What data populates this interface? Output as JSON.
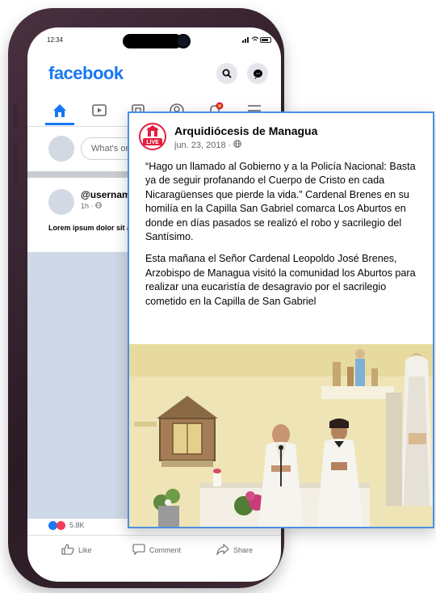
{
  "statusbar": {
    "time": "12:34"
  },
  "app": {
    "logo": "facebook"
  },
  "composer": {
    "placeholder": "What's on your mind?"
  },
  "feed_post": {
    "username": "@username",
    "meta": "1h · ",
    "text": "Lorem ipsum dolor sit amet, consectetur adipiscingelit."
  },
  "reactions": {
    "count": "5.8K"
  },
  "actions": {
    "like": "Like",
    "comment": "Comment",
    "share": "Share"
  },
  "card": {
    "page_name": "Arquidiócesis de Managua",
    "logo_badge": "LIVE",
    "date": "jun. 23, 2018 · ",
    "paragraph1": "“Hago un llamado al Gobierno y a la Policía Nacional: Basta ya de seguir profanando el Cuerpo de Cristo en cada Nicaragüenses que pierde la vida.” Cardenal Brenes en su homilía en la Capilla San Gabriel comarca Los Aburtos en donde en días pasados se realizó el robo y sacrilegio del Santísimo.",
    "paragraph2": "Esta mañana el Señor Cardenal Leopoldo José Brenes, Arzobispo de Managua visitó la comunidad los Aburtos para realizar una eucaristía de desagravio por el sacrilegio cometido en la Capilla de San Gabriel"
  },
  "colors": {
    "brand": "#1877f2",
    "card_border": "#4a90e2",
    "badge_red": "#e41e3f"
  },
  "icons": [
    "search-icon",
    "messenger-icon",
    "home-icon",
    "video-icon",
    "feed-icon",
    "profile-icon",
    "bell-icon",
    "menu-icon",
    "globe-icon",
    "like-icon",
    "comment-icon",
    "share-icon"
  ]
}
